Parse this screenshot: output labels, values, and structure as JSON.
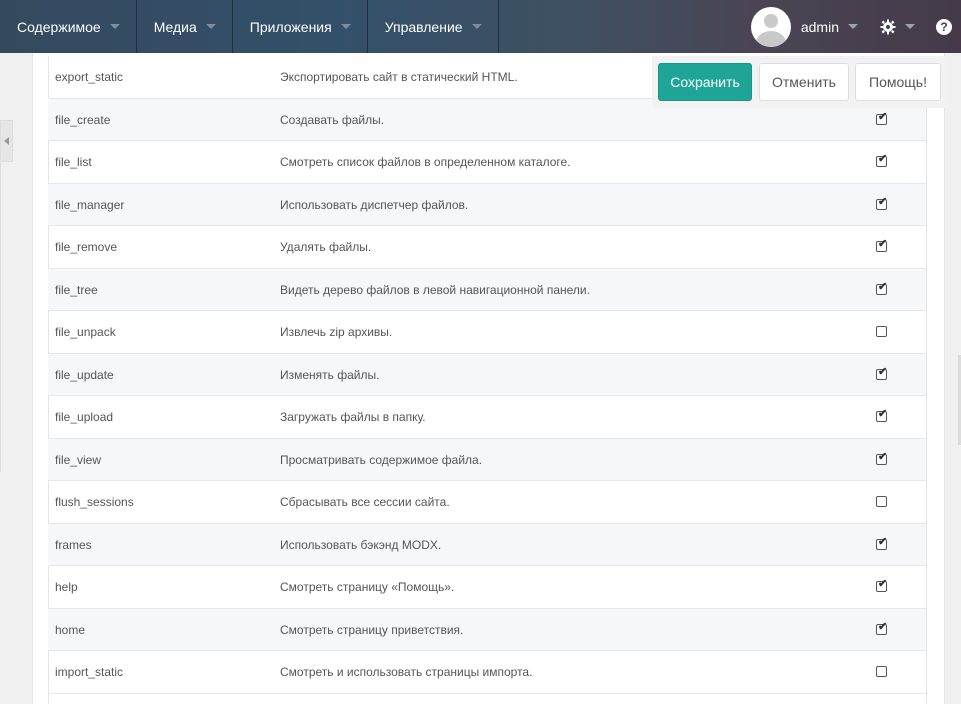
{
  "nav": {
    "items": [
      {
        "label": "Содержимое"
      },
      {
        "label": "Медиа"
      },
      {
        "label": "Приложения"
      },
      {
        "label": "Управление"
      }
    ],
    "user": "admin",
    "help_icon": "?"
  },
  "actions": {
    "save_label": "Сохранить",
    "cancel_label": "Отменить",
    "help_label": "Помощь!"
  },
  "permissions": [
    {
      "name": "export_static",
      "description": "Экспортировать сайт в статический HTML.",
      "checked": null
    },
    {
      "name": "file_create",
      "description": "Создавать файлы.",
      "checked": true
    },
    {
      "name": "file_list",
      "description": "Смотреть список файлов в определенном каталоге.",
      "checked": true
    },
    {
      "name": "file_manager",
      "description": "Использовать диспетчер файлов.",
      "checked": true
    },
    {
      "name": "file_remove",
      "description": "Удалять файлы.",
      "checked": true
    },
    {
      "name": "file_tree",
      "description": "Видеть дерево файлов в левой навигационной панели.",
      "checked": true
    },
    {
      "name": "file_unpack",
      "description": "Извлечь zip архивы.",
      "checked": false
    },
    {
      "name": "file_update",
      "description": "Изменять файлы.",
      "checked": true
    },
    {
      "name": "file_upload",
      "description": "Загружать файлы в папку.",
      "checked": true
    },
    {
      "name": "file_view",
      "description": "Просматривать содержимое файла.",
      "checked": true
    },
    {
      "name": "flush_sessions",
      "description": "Сбрасывать все сессии сайта.",
      "checked": false
    },
    {
      "name": "frames",
      "description": "Использовать бэкэнд MODX.",
      "checked": true
    },
    {
      "name": "help",
      "description": "Смотреть страницу «Помощь».",
      "checked": true
    },
    {
      "name": "home",
      "description": "Смотреть страницу приветствия.",
      "checked": true
    },
    {
      "name": "import_static",
      "description": "Смотреть и использовать страницы импорта.",
      "checked": false
    }
  ],
  "colors": {
    "accent": "#1fa598",
    "navbar": "#34495e"
  }
}
